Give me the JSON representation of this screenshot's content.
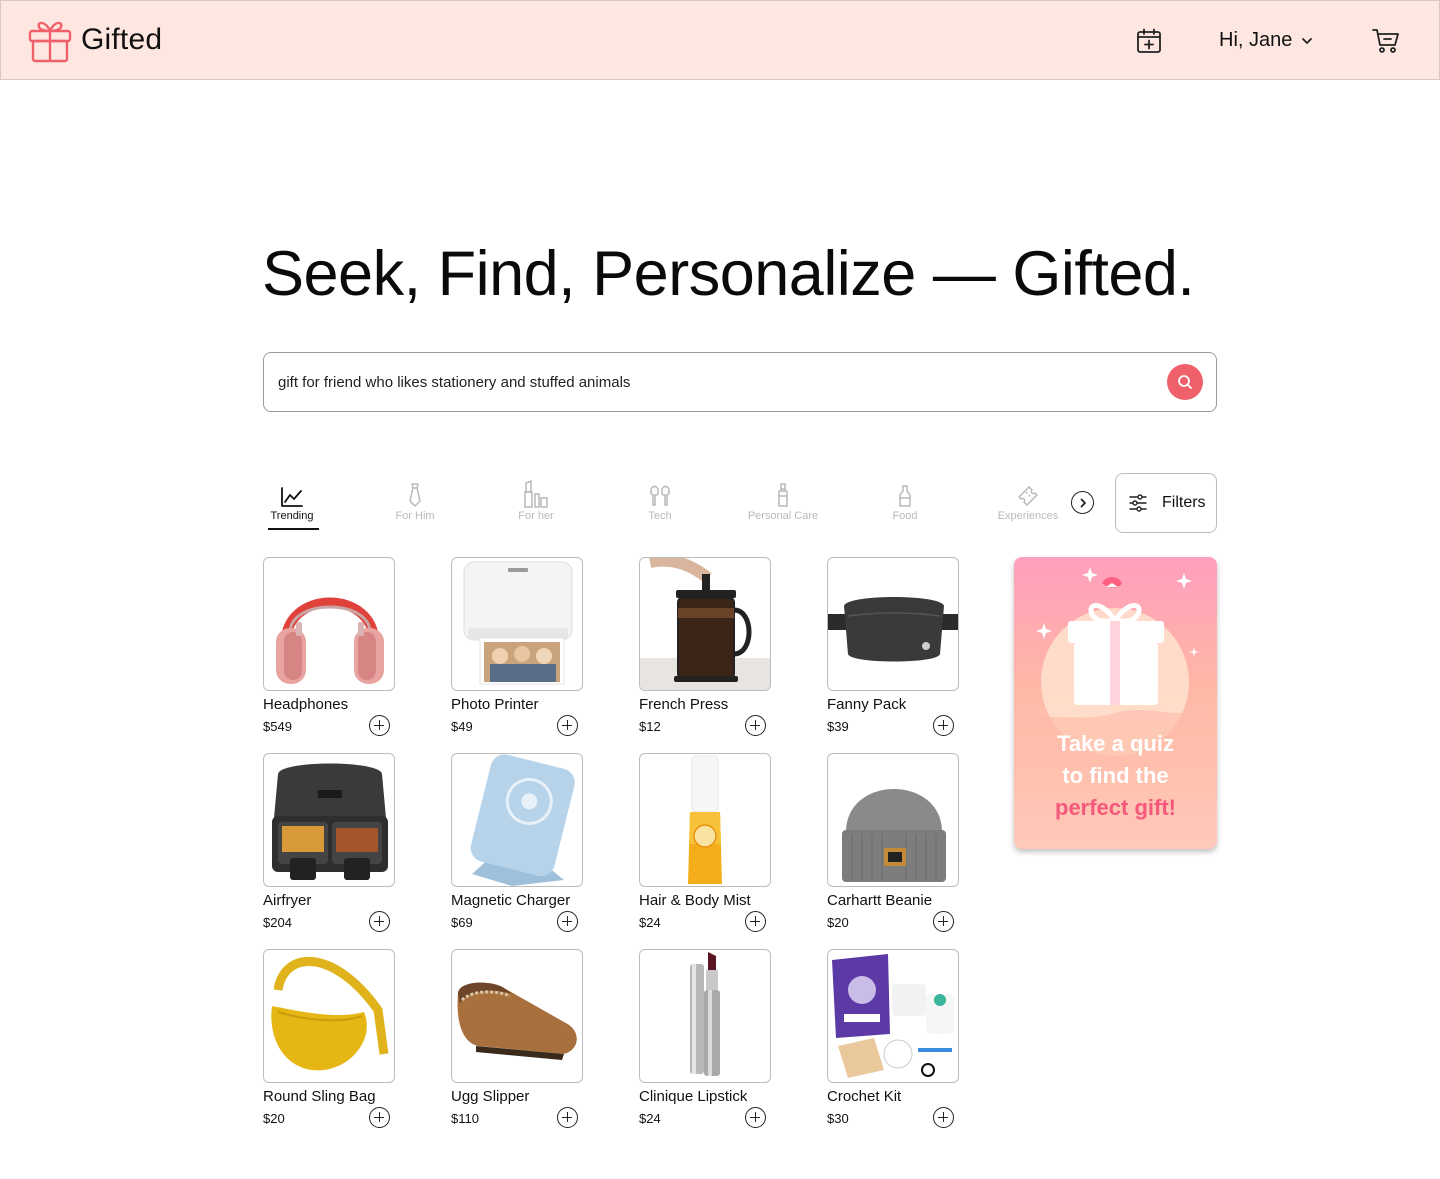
{
  "header": {
    "brand": "Gifted",
    "greeting": "Hi, Jane",
    "brand_color": "#f0606a",
    "background": "#ffe7e1"
  },
  "hero": {
    "title": "Seek, Find, Personalize — Gifted."
  },
  "search": {
    "value": "gift for friend who likes stationery and stuffed animals"
  },
  "categories": [
    {
      "label": "Trending",
      "icon": "trending-icon",
      "active": true
    },
    {
      "label": "For Him",
      "icon": "tie-icon",
      "active": false
    },
    {
      "label": "For her",
      "icon": "lipstick-icon",
      "active": false
    },
    {
      "label": "Tech",
      "icon": "earbuds-icon",
      "active": false
    },
    {
      "label": "Personal Care",
      "icon": "lotion-bottle-icon",
      "active": false
    },
    {
      "label": "Food",
      "icon": "bottle-icon",
      "active": false
    },
    {
      "label": "Experiences",
      "icon": "ticket-icon",
      "active": false
    }
  ],
  "filters_label": "Filters",
  "products": [
    {
      "name": "Headphones",
      "price": "$549",
      "image": "headphones"
    },
    {
      "name": "Photo Printer",
      "price": "$49",
      "image": "photo-printer"
    },
    {
      "name": "French Press",
      "price": "$12",
      "image": "french-press"
    },
    {
      "name": "Fanny Pack",
      "price": "$39",
      "image": "fanny-pack"
    },
    {
      "name": "Airfryer",
      "price": "$204",
      "image": "airfryer"
    },
    {
      "name": "Magnetic Charger",
      "price": "$69",
      "image": "magnetic-charger"
    },
    {
      "name": "Hair & Body Mist",
      "price": "$24",
      "image": "body-mist"
    },
    {
      "name": "Carhartt Beanie",
      "price": "$20",
      "image": "beanie"
    },
    {
      "name": "Round Sling Bag",
      "price": "$20",
      "image": "sling-bag"
    },
    {
      "name": "Ugg Slipper",
      "price": "$110",
      "image": "slipper"
    },
    {
      "name": "Clinique Lipstick",
      "price": "$24",
      "image": "lipstick"
    },
    {
      "name": "Crochet Kit",
      "price": "$30",
      "image": "crochet-kit"
    }
  ],
  "quiz": {
    "line1": "Take a quiz",
    "line2": "to find the",
    "line3": "perfect gift!"
  }
}
